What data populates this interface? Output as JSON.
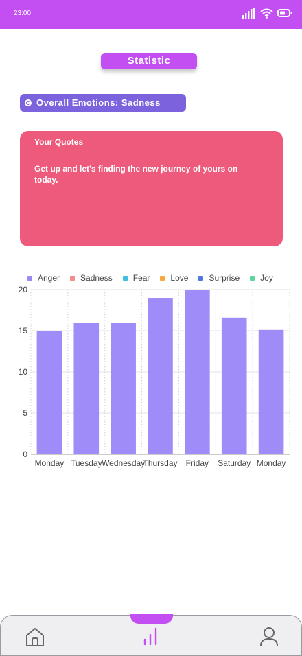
{
  "status_bar": {
    "time": "23:00"
  },
  "header": {
    "title": "Statistic"
  },
  "emotion": {
    "label": "Overall Emotions: Sadness"
  },
  "quote": {
    "title": "Your Quotes",
    "text": "Get up and let's finding the new journey of yours on today."
  },
  "colors": {
    "accent": "#c34ff3",
    "emotion_pill": "#7c63dd",
    "quote_card": "#ee5a7c",
    "bar": "#a08cf8"
  },
  "legend": [
    {
      "label": "Anger",
      "color": "#9b87f5"
    },
    {
      "label": "Sadness",
      "color": "#f08c8a"
    },
    {
      "label": "Fear",
      "color": "#3bbfe0"
    },
    {
      "label": "Love",
      "color": "#f5a83b"
    },
    {
      "label": "Surprise",
      "color": "#4f78e0"
    },
    {
      "label": "Joy",
      "color": "#5fd3a0"
    }
  ],
  "chart_data": {
    "type": "bar",
    "categories": [
      "Monday",
      "Tuesday",
      "Wednesday",
      "Thursday",
      "Friday",
      "Saturday",
      "Monday"
    ],
    "series": [
      {
        "name": "Anger",
        "values": [
          15,
          16,
          16,
          19,
          20,
          16.6,
          15.1
        ]
      }
    ],
    "ylim": [
      0,
      20
    ],
    "yticks": [
      "0",
      "5",
      "10",
      "15",
      "20"
    ],
    "grid": true,
    "legend_position": "top"
  },
  "nav": {
    "items": [
      {
        "name": "home",
        "icon": "home-icon"
      },
      {
        "name": "statistics",
        "icon": "bar-chart-icon"
      },
      {
        "name": "profile",
        "icon": "user-icon"
      }
    ]
  }
}
